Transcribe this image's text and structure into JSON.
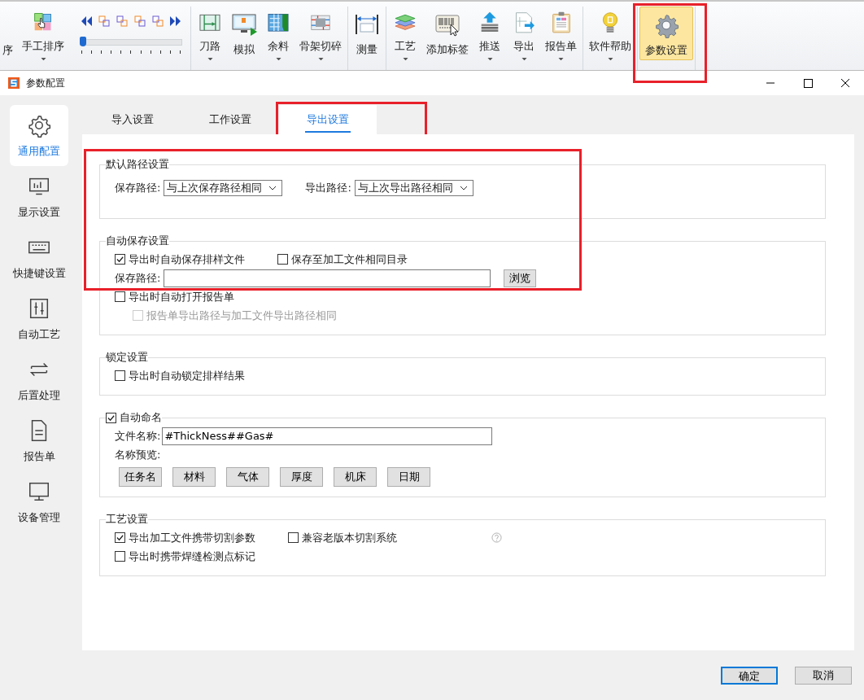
{
  "ribbon": {
    "groups": [
      {
        "items": [
          {
            "kind": "cut",
            "label": "序"
          },
          {
            "kind": "button",
            "label": "手工排序",
            "dropdown": true
          },
          {
            "kind": "slider",
            "level": 0
          }
        ]
      },
      {
        "items": [
          {
            "kind": "button",
            "label": "刀路",
            "dropdown": true
          },
          {
            "kind": "button",
            "label": "模拟",
            "dropdown": false
          },
          {
            "kind": "button",
            "label": "余料",
            "dropdown": true
          },
          {
            "kind": "button",
            "label": "骨架切碎",
            "dropdown": true
          }
        ]
      },
      {
        "items": [
          {
            "kind": "button",
            "label": "测量",
            "dropdown": false
          }
        ]
      },
      {
        "items": [
          {
            "kind": "button",
            "label": "工艺",
            "dropdown": true
          },
          {
            "kind": "button",
            "label": "添加标签",
            "dropdown": false
          },
          {
            "kind": "button",
            "label": "推送",
            "dropdown": true
          },
          {
            "kind": "button",
            "label": "导出",
            "dropdown": true
          },
          {
            "kind": "button",
            "label": "报告单",
            "dropdown": true
          }
        ]
      },
      {
        "items": [
          {
            "kind": "button",
            "label": "软件帮助",
            "dropdown": true
          }
        ]
      },
      {
        "items": [
          {
            "kind": "button",
            "label": "参数设置",
            "dropdown": false,
            "selected": true,
            "highlighted": true
          }
        ]
      }
    ]
  },
  "dialog": {
    "title": "参数配置",
    "sidebar": [
      {
        "label": "通用配置",
        "selected": true
      },
      {
        "label": "显示设置",
        "selected": false
      },
      {
        "label": "快捷键设置",
        "selected": false
      },
      {
        "label": "自动工艺",
        "selected": false
      },
      {
        "label": "后置处理",
        "selected": false
      },
      {
        "label": "报告单",
        "selected": false
      },
      {
        "label": "设备管理",
        "selected": false
      }
    ],
    "tabs": [
      {
        "label": "导入设置",
        "selected": false,
        "highlighted": false
      },
      {
        "label": "工作设置",
        "selected": false,
        "highlighted": false
      },
      {
        "label": "导出设置",
        "selected": true,
        "highlighted": true
      }
    ],
    "sections": [
      {
        "title": "默认路径设置",
        "highlighted": true,
        "rows": [
          {
            "kind": "selects",
            "fields": [
              {
                "label": "保存路径:",
                "value": "与上次保存路径相同"
              },
              {
                "label": "导出路径:",
                "value": "与上次导出路径相同"
              }
            ]
          }
        ]
      },
      {
        "title": "自动保存设置",
        "rows": [
          {
            "kind": "checks",
            "items": [
              {
                "label": "导出时自动保存排样文件",
                "checked": true,
                "disabled": false
              },
              {
                "label": "保存至加工文件相同目录",
                "checked": false,
                "disabled": false
              }
            ]
          },
          {
            "kind": "path",
            "label": "保存路径:",
            "button": "浏览"
          },
          {
            "kind": "checks",
            "items": [
              {
                "label": "导出时自动打开报告单",
                "checked": false,
                "disabled": false,
                "children": [
                  {
                    "label": "报告单导出路径与加工文件导出路径相同",
                    "checked": false,
                    "disabled": true
                  }
                ]
              }
            ]
          }
        ]
      },
      {
        "title": "锁定设置",
        "rows": [
          {
            "kind": "checks",
            "items": [
              {
                "label": "导出时自动锁定排样结果",
                "checked": false,
                "disabled": false
              }
            ]
          }
        ]
      },
      {
        "title": "自动命名",
        "checked": true,
        "rows": [
          {
            "kind": "field",
            "label": "文件名称:",
            "value": "#ThickNess##Gas#"
          },
          {
            "kind": "label",
            "text": "名称预览:"
          },
          {
            "kind": "buttons",
            "items": [
              "任务名",
              "材料",
              "气体",
              "厚度",
              "机床",
              "日期"
            ]
          }
        ]
      },
      {
        "title": "工艺设置",
        "rows": [
          {
            "kind": "checks",
            "help": true,
            "items": [
              {
                "label": "导出加工文件携带切割参数",
                "checked": true,
                "disabled": false
              },
              {
                "label": "兼容老版本切割系统",
                "checked": false,
                "disabled": false
              }
            ]
          },
          {
            "kind": "checks",
            "items": [
              {
                "label": "导出时携带焊缝检测点标记",
                "checked": false,
                "disabled": false
              }
            ]
          }
        ]
      }
    ],
    "buttons": [
      {
        "label": "确定",
        "default": true
      },
      {
        "label": "取消",
        "default": false
      }
    ]
  }
}
